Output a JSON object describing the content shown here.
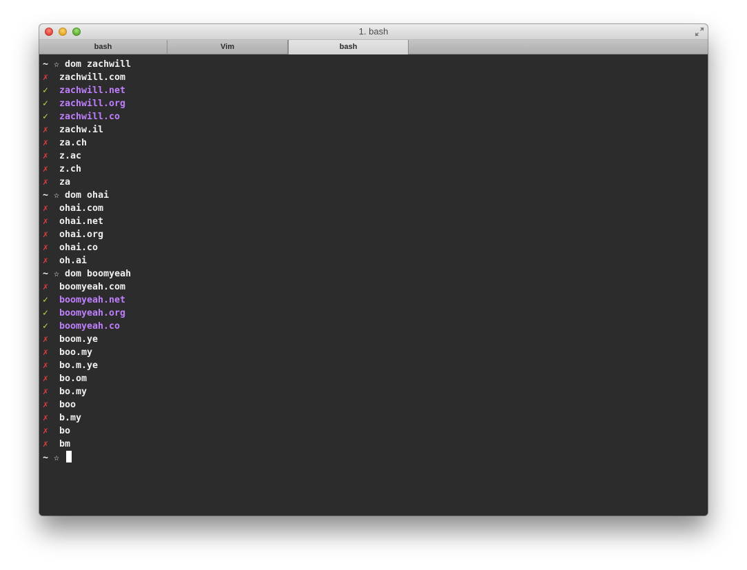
{
  "window": {
    "title": "1. bash"
  },
  "tabs": [
    {
      "label": "bash",
      "active": false
    },
    {
      "label": "Vim",
      "active": false
    },
    {
      "label": "bash",
      "active": true
    }
  ],
  "prompt": {
    "tilde": "~",
    "star": "☆"
  },
  "marks": {
    "fail": "✗",
    "ok": "✓"
  },
  "colors": {
    "background": "#2c2c2c",
    "fail_mark": "#e03c3c",
    "ok_mark": "#b8e04a",
    "available_domain": "#bf7fff",
    "text": "#f0f0f0"
  },
  "sessions": [
    {
      "command": "dom zachwill",
      "results": [
        {
          "status": "fail",
          "domain": "zachwill.com"
        },
        {
          "status": "ok",
          "domain": "zachwill.net"
        },
        {
          "status": "ok",
          "domain": "zachwill.org"
        },
        {
          "status": "ok",
          "domain": "zachwill.co"
        },
        {
          "status": "fail",
          "domain": "zachw.il"
        },
        {
          "status": "fail",
          "domain": "za.ch"
        },
        {
          "status": "fail",
          "domain": "z.ac"
        },
        {
          "status": "fail",
          "domain": "z.ch"
        },
        {
          "status": "fail",
          "domain": "za"
        }
      ]
    },
    {
      "command": "dom ohai",
      "results": [
        {
          "status": "fail",
          "domain": "ohai.com"
        },
        {
          "status": "fail",
          "domain": "ohai.net"
        },
        {
          "status": "fail",
          "domain": "ohai.org"
        },
        {
          "status": "fail",
          "domain": "ohai.co"
        },
        {
          "status": "fail",
          "domain": "oh.ai"
        }
      ]
    },
    {
      "command": "dom boomyeah",
      "results": [
        {
          "status": "fail",
          "domain": "boomyeah.com"
        },
        {
          "status": "ok",
          "domain": "boomyeah.net"
        },
        {
          "status": "ok",
          "domain": "boomyeah.org"
        },
        {
          "status": "ok",
          "domain": "boomyeah.co"
        },
        {
          "status": "fail",
          "domain": "boom.ye"
        },
        {
          "status": "fail",
          "domain": "boo.my"
        },
        {
          "status": "fail",
          "domain": "bo.m.ye"
        },
        {
          "status": "fail",
          "domain": "bo.om"
        },
        {
          "status": "fail",
          "domain": "bo.my"
        },
        {
          "status": "fail",
          "domain": "boo"
        },
        {
          "status": "fail",
          "domain": "b.my"
        },
        {
          "status": "fail",
          "domain": "bo"
        },
        {
          "status": "fail",
          "domain": "bm"
        }
      ]
    }
  ],
  "current_input": ""
}
